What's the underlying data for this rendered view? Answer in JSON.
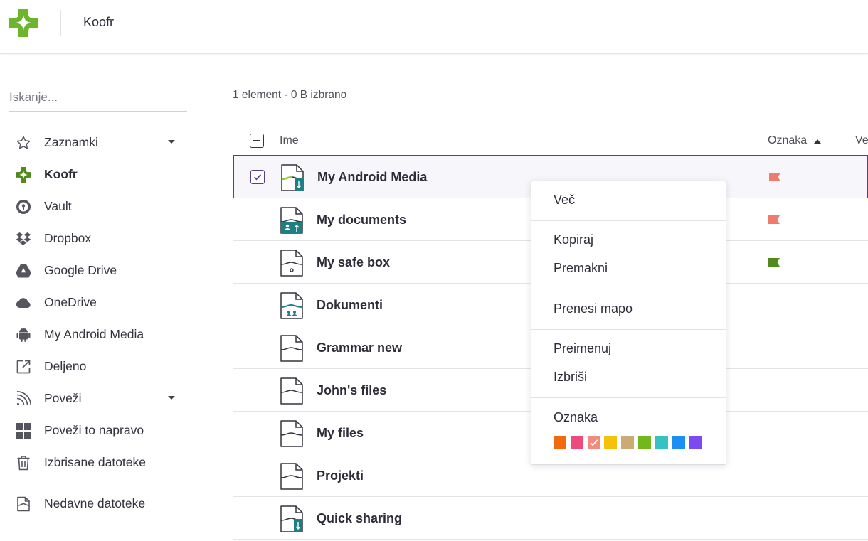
{
  "header": {
    "title": "Koofr"
  },
  "search": {
    "placeholder": "Iskanje..."
  },
  "sidebar": {
    "items": [
      {
        "label": "Zaznamki",
        "icon": "star-icon",
        "caret": true,
        "active": false
      },
      {
        "label": "Koofr",
        "icon": "koofr-logo-icon",
        "caret": false,
        "active": true
      },
      {
        "label": "Vault",
        "icon": "vault-icon",
        "caret": false,
        "active": false
      },
      {
        "label": "Dropbox",
        "icon": "dropbox-icon",
        "caret": false,
        "active": false
      },
      {
        "label": "Google Drive",
        "icon": "google-drive-icon",
        "caret": false,
        "active": false
      },
      {
        "label": "OneDrive",
        "icon": "cloud-icon",
        "caret": false,
        "active": false
      },
      {
        "label": "My Android Media",
        "icon": "android-icon",
        "caret": false,
        "active": false
      },
      {
        "label": "Deljeno",
        "icon": "share-icon",
        "caret": false,
        "active": false
      },
      {
        "label": "Poveži",
        "icon": "rss-icon",
        "caret": true,
        "active": false
      },
      {
        "label": "Poveži to napravo",
        "icon": "windows-icon",
        "caret": false,
        "active": false
      },
      {
        "label": "Izbrisane datoteke",
        "icon": "trash-icon",
        "caret": false,
        "active": false
      },
      {
        "label": "Nedavne datoteke",
        "icon": "recent-file-icon",
        "caret": false,
        "active": false
      }
    ]
  },
  "main": {
    "selection_info": "1 element - 0 B izbrano",
    "columns": {
      "name": "Ime",
      "label": "Oznaka",
      "more": "Ve"
    },
    "files": [
      {
        "name": "My Android Media",
        "icon": "android-media-folder-icon",
        "selected": true,
        "flag_color": "#ef7b6e"
      },
      {
        "name": "My documents",
        "icon": "documents-folder-icon",
        "selected": false,
        "flag_color": "#ef7b6e"
      },
      {
        "name": "My safe box",
        "icon": "safe-box-folder-icon",
        "selected": false,
        "flag_color": "#4f8a1b"
      },
      {
        "name": "Dokumenti",
        "icon": "shared-folder-icon",
        "selected": false,
        "flag_color": ""
      },
      {
        "name": "Grammar new",
        "icon": "folder-icon",
        "selected": false,
        "flag_color": ""
      },
      {
        "name": "John's files",
        "icon": "folder-icon",
        "selected": false,
        "flag_color": ""
      },
      {
        "name": "My files",
        "icon": "folder-icon",
        "selected": false,
        "flag_color": ""
      },
      {
        "name": "Projekti",
        "icon": "folder-icon",
        "selected": false,
        "flag_color": ""
      },
      {
        "name": "Quick sharing",
        "icon": "quick-sharing-folder-icon",
        "selected": false,
        "flag_color": ""
      }
    ]
  },
  "context_menu": {
    "more": "Več",
    "copy": "Kopiraj",
    "move": "Premakni",
    "download": "Prenesi mapo",
    "rename": "Preimenuj",
    "delete": "Izbriši",
    "label": "Oznaka",
    "colors": [
      "#f26a0d",
      "#ef4a7b",
      "#f28b7e",
      "#f5c20b",
      "#cdaa72",
      "#71b81b",
      "#36c1c5",
      "#1e8ff2",
      "#7d4af2"
    ],
    "selected_color_index": 2
  }
}
